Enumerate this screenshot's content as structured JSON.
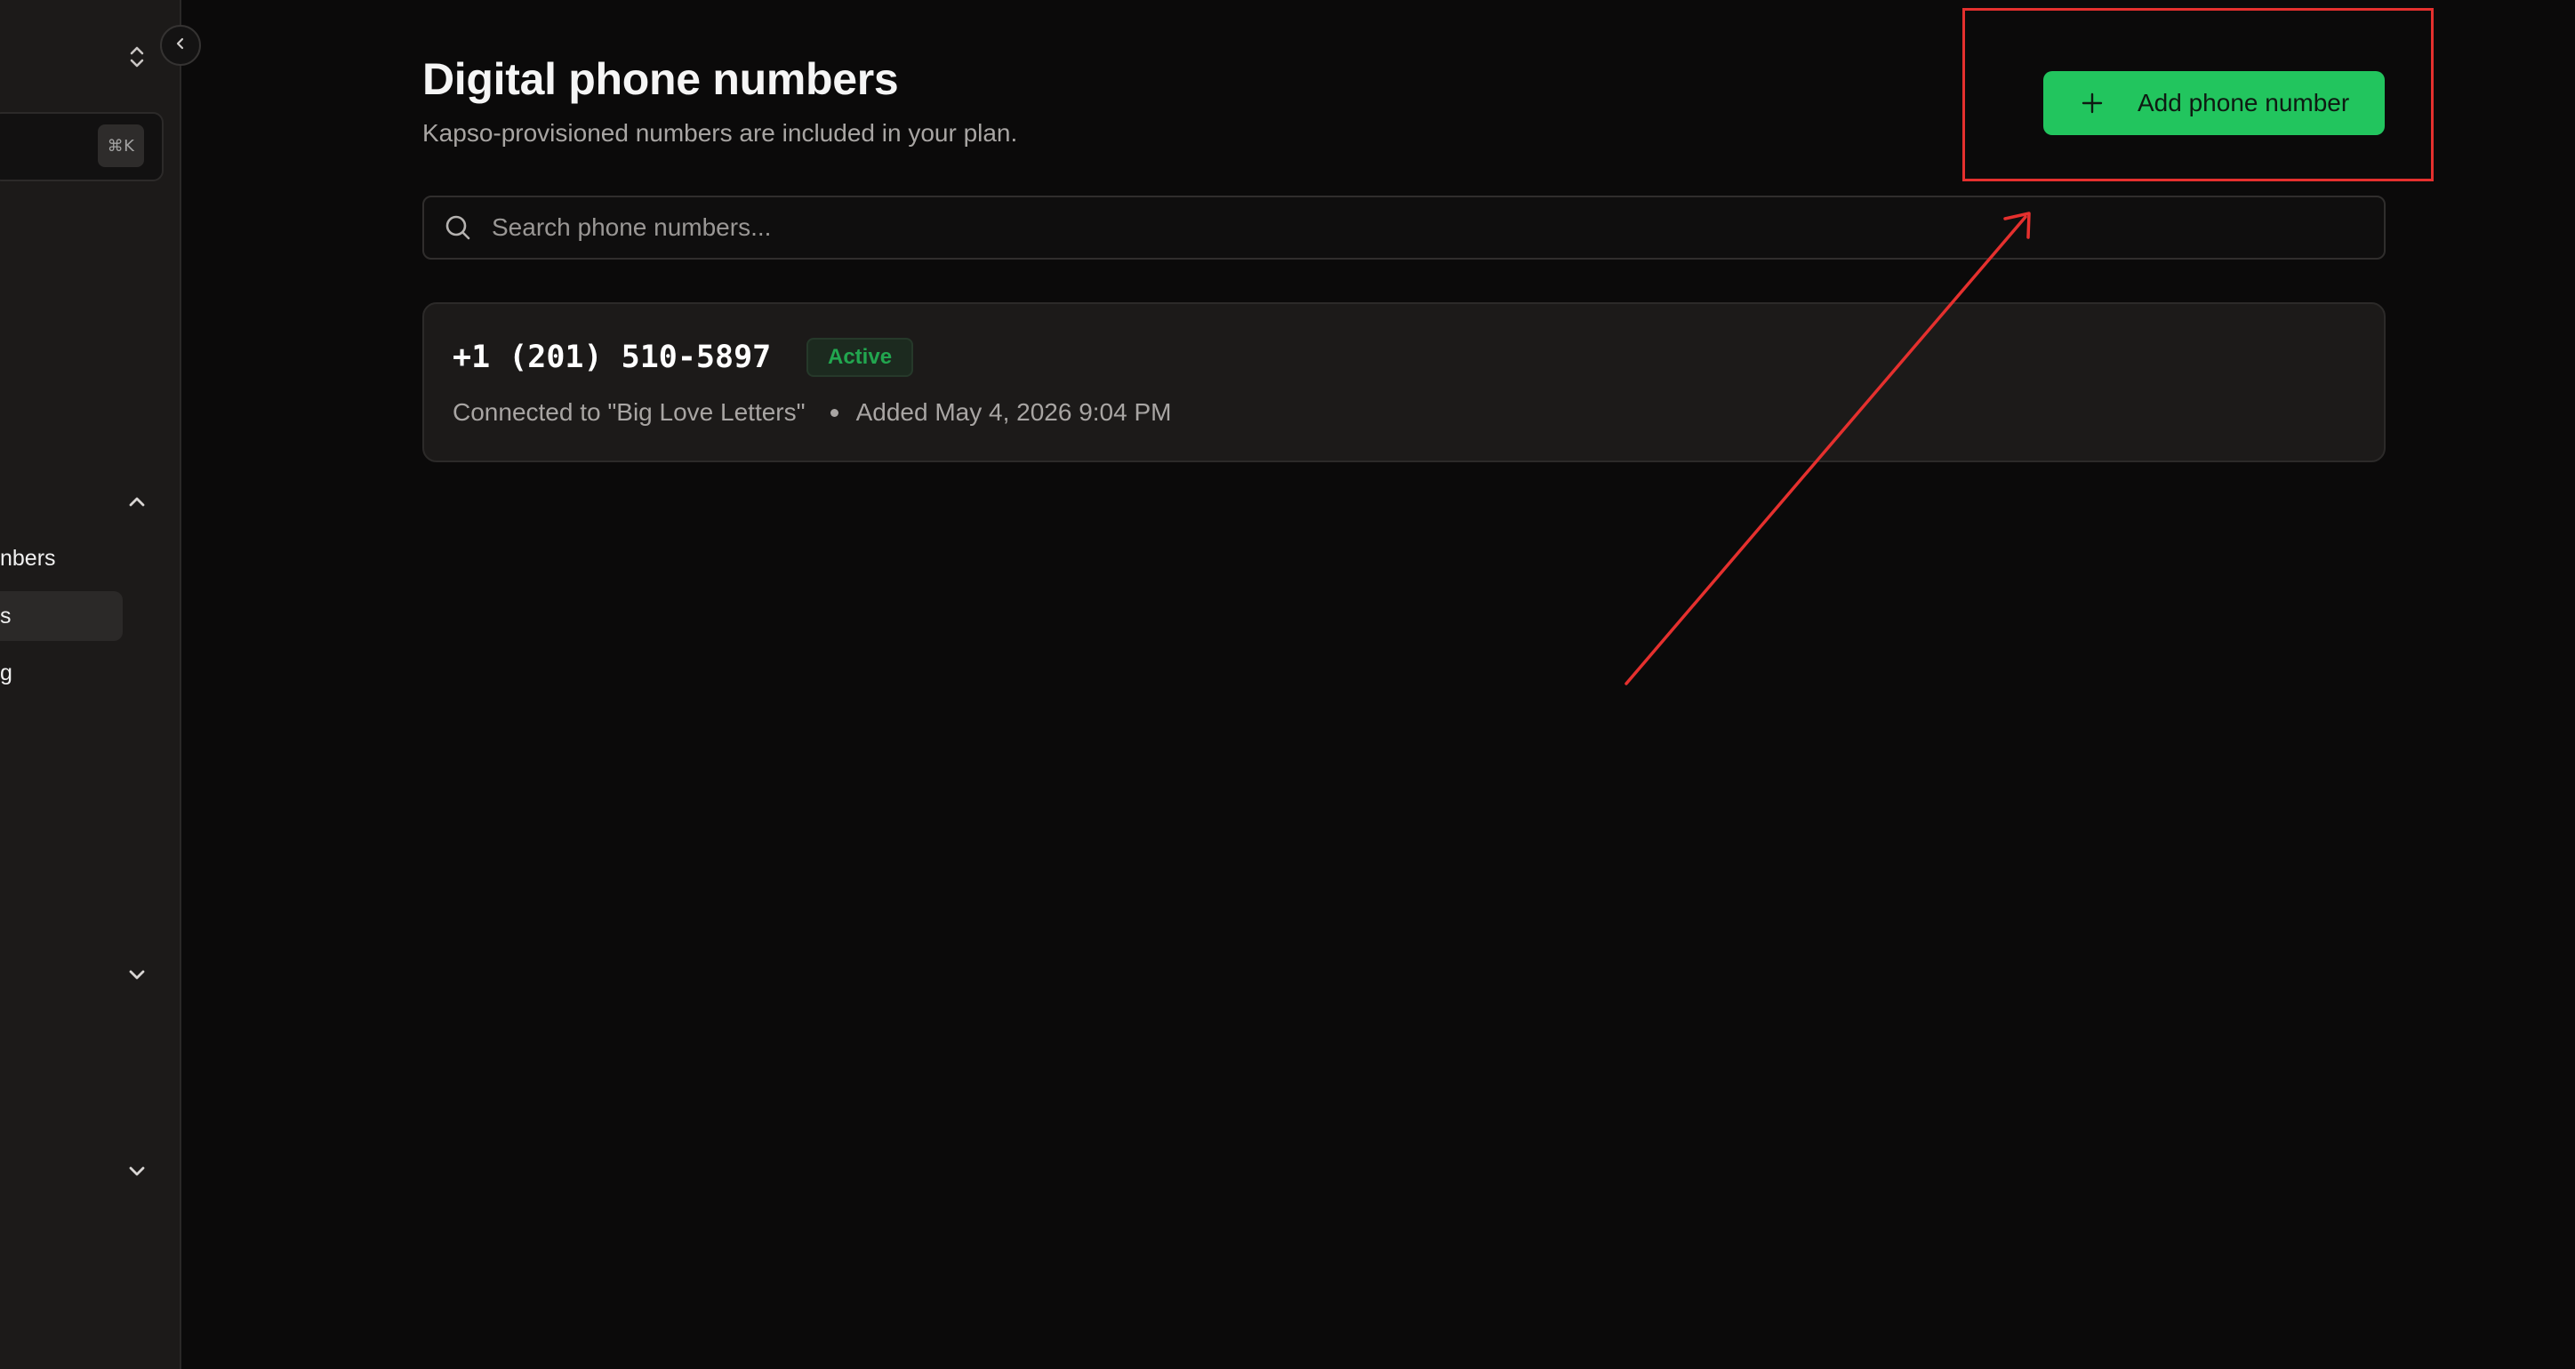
{
  "sidebar": {
    "shortcut": "⌘K",
    "items": [
      {
        "label": "nbers"
      },
      {
        "label": "s"
      },
      {
        "label": "g"
      }
    ]
  },
  "header": {
    "title": "Digital phone numbers",
    "subtitle": "Kapso-provisioned numbers are included in your plan.",
    "add_button_label": "Add phone number"
  },
  "search": {
    "placeholder": "Search phone numbers..."
  },
  "phone_numbers": [
    {
      "number": "+1 (201) 510-5897",
      "status": "Active",
      "connected": "Connected to \"Big Love Letters\"",
      "added": "Added May 4, 2026 9:04 PM"
    }
  ],
  "colors": {
    "accent": "#22c55e",
    "annotation": "#e5302e",
    "status_active": "#22a64f"
  },
  "icons": [
    "chevrons-up-down-icon",
    "chevron-left-icon",
    "chevron-up-icon",
    "chevron-down-icon",
    "plus-icon",
    "search-icon"
  ]
}
